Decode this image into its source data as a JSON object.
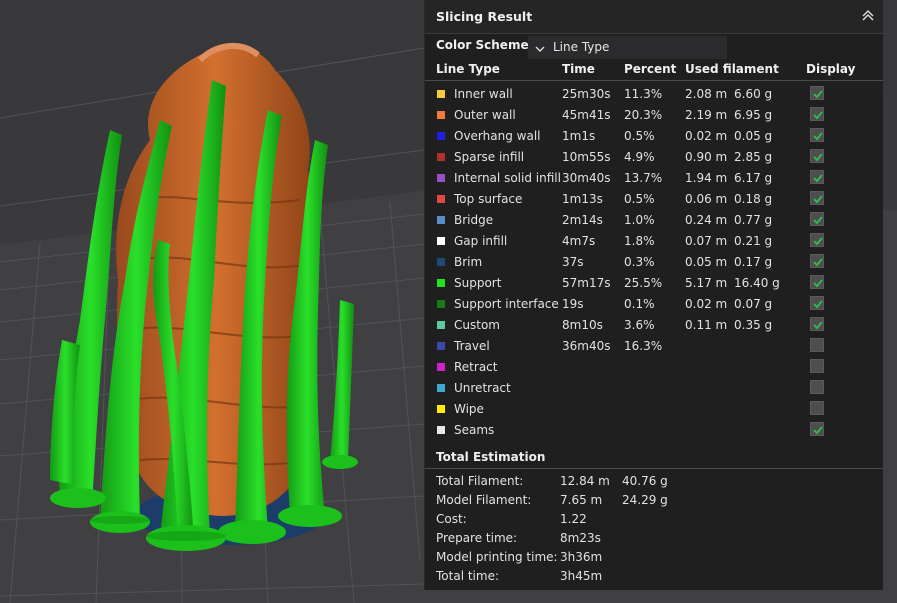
{
  "panel": {
    "title": "Slicing Result",
    "color_scheme_label": "Color Scheme",
    "color_scheme_value": "Line Type",
    "headers": {
      "line_type": "Line Type",
      "time": "Time",
      "percent": "Percent",
      "used_filament": "Used filament",
      "display": "Display"
    },
    "rows": [
      {
        "name": "Inner wall",
        "color": "#f5cd3d",
        "time": "25m30s",
        "percent": "11.3%",
        "length": "2.08 m",
        "weight": "6.60 g",
        "display": true
      },
      {
        "name": "Outer wall",
        "color": "#f07b3a",
        "time": "45m41s",
        "percent": "20.3%",
        "length": "2.19 m",
        "weight": "6.95 g",
        "display": true
      },
      {
        "name": "Overhang wall",
        "color": "#2020e0",
        "time": "1m1s",
        "percent": "0.5%",
        "length": "0.02 m",
        "weight": "0.05 g",
        "display": true
      },
      {
        "name": "Sparse infill",
        "color": "#b03030",
        "time": "10m55s",
        "percent": "4.9%",
        "length": "0.90 m",
        "weight": "2.85 g",
        "display": true
      },
      {
        "name": "Internal solid infill",
        "color": "#9a4fc8",
        "time": "30m40s",
        "percent": "13.7%",
        "length": "1.94 m",
        "weight": "6.17 g",
        "display": true
      },
      {
        "name": "Top surface",
        "color": "#e04848",
        "time": "1m13s",
        "percent": "0.5%",
        "length": "0.06 m",
        "weight": "0.18 g",
        "display": true
      },
      {
        "name": "Bridge",
        "color": "#5a8cc8",
        "time": "2m14s",
        "percent": "1.0%",
        "length": "0.24 m",
        "weight": "0.77 g",
        "display": true
      },
      {
        "name": "Gap infill",
        "color": "#ffffff",
        "time": "4m7s",
        "percent": "1.8%",
        "length": "0.07 m",
        "weight": "0.21 g",
        "display": true
      },
      {
        "name": "Brim",
        "color": "#1e4a78",
        "time": "37s",
        "percent": "0.3%",
        "length": "0.05 m",
        "weight": "0.17 g",
        "display": true
      },
      {
        "name": "Support",
        "color": "#22e022",
        "time": "57m17s",
        "percent": "25.5%",
        "length": "5.17 m",
        "weight": "16.40 g",
        "display": true
      },
      {
        "name": "Support interface",
        "color": "#1a7a1a",
        "time": "19s",
        "percent": "0.1%",
        "length": "0.02 m",
        "weight": "0.07 g",
        "display": true
      },
      {
        "name": "Custom",
        "color": "#5cc8a0",
        "time": "8m10s",
        "percent": "3.6%",
        "length": "0.11 m",
        "weight": "0.35 g",
        "display": true
      },
      {
        "name": "Travel",
        "color": "#3a4aa8",
        "time": "36m40s",
        "percent": "16.3%",
        "length": "",
        "weight": "",
        "display": false
      },
      {
        "name": "Retract",
        "color": "#d020d0",
        "time": "",
        "percent": "",
        "length": "",
        "weight": "",
        "display": false
      },
      {
        "name": "Unretract",
        "color": "#40a8d0",
        "time": "",
        "percent": "",
        "length": "",
        "weight": "",
        "display": false
      },
      {
        "name": "Wipe",
        "color": "#ffee00",
        "time": "",
        "percent": "",
        "length": "",
        "weight": "",
        "display": false
      },
      {
        "name": "Seams",
        "color": "#e8e8e8",
        "time": "",
        "percent": "",
        "length": "",
        "weight": "",
        "display": true
      }
    ],
    "total": {
      "title": "Total Estimation",
      "items": [
        {
          "label": "Total Filament:",
          "v1": "12.84 m",
          "v2": "40.76 g"
        },
        {
          "label": "Model Filament:",
          "v1": "7.65 m",
          "v2": "24.29 g"
        },
        {
          "label": "Cost:",
          "v1": "1.22",
          "v2": ""
        },
        {
          "label": "Prepare time:",
          "v1": "8m23s",
          "v2": ""
        },
        {
          "label": "Model printing time:",
          "v1": "3h36m",
          "v2": ""
        },
        {
          "label": "Total time:",
          "v1": "3h45m",
          "v2": ""
        }
      ]
    }
  },
  "viewport": {
    "model_color": "#c8642a",
    "support_color": "#1fd21f",
    "brim_color": "#1c3c6a",
    "bed_color": "#414143",
    "grid_color": "#5a5a5e",
    "background_color": "#3a3a3c"
  }
}
